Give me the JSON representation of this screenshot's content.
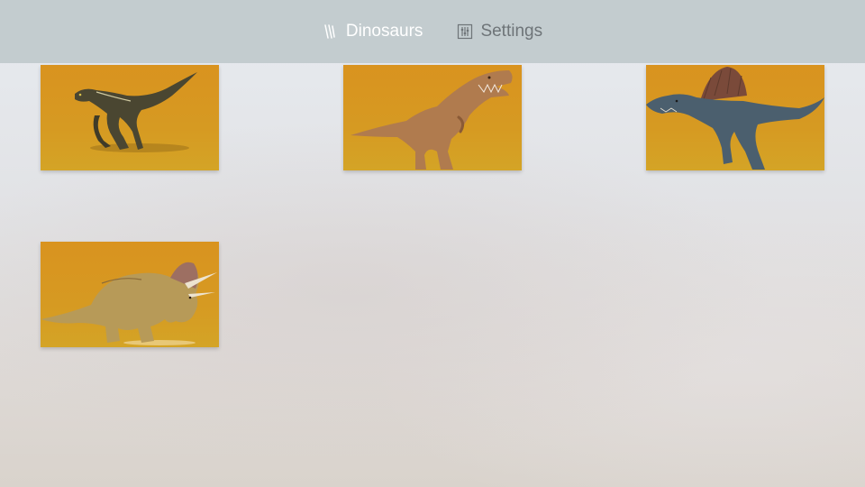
{
  "nav": {
    "tabs": [
      {
        "label": "Dinosaurs",
        "icon": "claw-marks-icon",
        "selected": true
      },
      {
        "label": "Settings",
        "icon": "sliders-icon",
        "selected": false
      }
    ]
  },
  "grid": {
    "items": [
      {
        "subject": "raptor"
      },
      {
        "subject": "tyrannosaurus"
      },
      {
        "subject": "spinosaurus"
      },
      {
        "subject": "triceratops"
      }
    ]
  },
  "colors": {
    "top_bar": "#c3cccf",
    "tile_background": "#d69a22",
    "selected_tab_text": "#ffffff",
    "tab_text": "#6e7478"
  }
}
